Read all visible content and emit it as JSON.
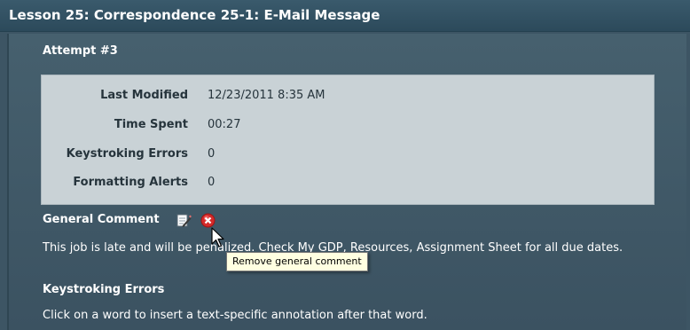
{
  "header": {
    "title": "Lesson 25: Correspondence 25-1: E-Mail Message"
  },
  "attempt": {
    "label": "Attempt #3"
  },
  "details": [
    {
      "label": "Last Modified",
      "value": "12/23/2011 8:35 AM"
    },
    {
      "label": "Time Spent",
      "value": "00:27"
    },
    {
      "label": "Keystroking Errors",
      "value": "0"
    },
    {
      "label": "Formatting Alerts",
      "value": "0"
    }
  ],
  "general_comment": {
    "label": "General Comment",
    "edit_icon": "edit-pencil-icon",
    "remove_icon": "remove-x-icon",
    "text": "This job is late and will be penalized. Check My GDP, Resources, Assignment Sheet for all due dates."
  },
  "tooltip": {
    "text": "Remove general comment"
  },
  "keystroking_errors": {
    "label": "Keystroking Errors",
    "instruction": "Click on a word to insert a text-specific annotation after that word."
  },
  "colors": {
    "background": "#3d5564",
    "info_box": "#c9d2d6",
    "remove_icon": "#d42a2a",
    "tooltip_bg": "#ffffe1"
  }
}
